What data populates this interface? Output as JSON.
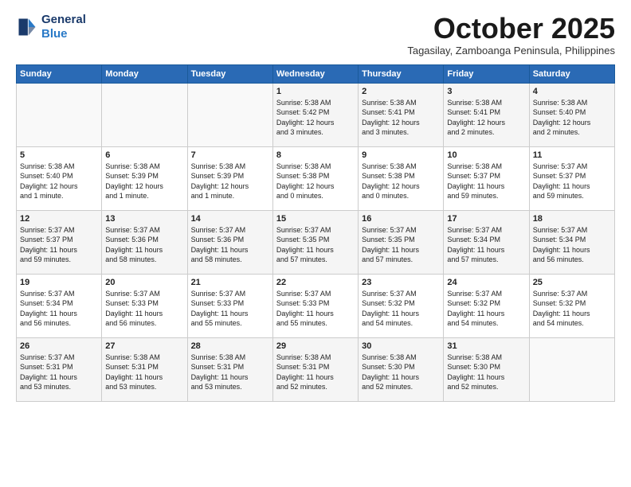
{
  "header": {
    "logo_line1": "General",
    "logo_line2": "Blue",
    "month_title": "October 2025",
    "subtitle": "Tagasilay, Zamboanga Peninsula, Philippines"
  },
  "weekdays": [
    "Sunday",
    "Monday",
    "Tuesday",
    "Wednesday",
    "Thursday",
    "Friday",
    "Saturday"
  ],
  "weeks": [
    [
      {
        "day": "",
        "info": ""
      },
      {
        "day": "",
        "info": ""
      },
      {
        "day": "",
        "info": ""
      },
      {
        "day": "1",
        "info": "Sunrise: 5:38 AM\nSunset: 5:42 PM\nDaylight: 12 hours\nand 3 minutes."
      },
      {
        "day": "2",
        "info": "Sunrise: 5:38 AM\nSunset: 5:41 PM\nDaylight: 12 hours\nand 3 minutes."
      },
      {
        "day": "3",
        "info": "Sunrise: 5:38 AM\nSunset: 5:41 PM\nDaylight: 12 hours\nand 2 minutes."
      },
      {
        "day": "4",
        "info": "Sunrise: 5:38 AM\nSunset: 5:40 PM\nDaylight: 12 hours\nand 2 minutes."
      }
    ],
    [
      {
        "day": "5",
        "info": "Sunrise: 5:38 AM\nSunset: 5:40 PM\nDaylight: 12 hours\nand 1 minute."
      },
      {
        "day": "6",
        "info": "Sunrise: 5:38 AM\nSunset: 5:39 PM\nDaylight: 12 hours\nand 1 minute."
      },
      {
        "day": "7",
        "info": "Sunrise: 5:38 AM\nSunset: 5:39 PM\nDaylight: 12 hours\nand 1 minute."
      },
      {
        "day": "8",
        "info": "Sunrise: 5:38 AM\nSunset: 5:38 PM\nDaylight: 12 hours\nand 0 minutes."
      },
      {
        "day": "9",
        "info": "Sunrise: 5:38 AM\nSunset: 5:38 PM\nDaylight: 12 hours\nand 0 minutes."
      },
      {
        "day": "10",
        "info": "Sunrise: 5:38 AM\nSunset: 5:37 PM\nDaylight: 11 hours\nand 59 minutes."
      },
      {
        "day": "11",
        "info": "Sunrise: 5:37 AM\nSunset: 5:37 PM\nDaylight: 11 hours\nand 59 minutes."
      }
    ],
    [
      {
        "day": "12",
        "info": "Sunrise: 5:37 AM\nSunset: 5:37 PM\nDaylight: 11 hours\nand 59 minutes."
      },
      {
        "day": "13",
        "info": "Sunrise: 5:37 AM\nSunset: 5:36 PM\nDaylight: 11 hours\nand 58 minutes."
      },
      {
        "day": "14",
        "info": "Sunrise: 5:37 AM\nSunset: 5:36 PM\nDaylight: 11 hours\nand 58 minutes."
      },
      {
        "day": "15",
        "info": "Sunrise: 5:37 AM\nSunset: 5:35 PM\nDaylight: 11 hours\nand 57 minutes."
      },
      {
        "day": "16",
        "info": "Sunrise: 5:37 AM\nSunset: 5:35 PM\nDaylight: 11 hours\nand 57 minutes."
      },
      {
        "day": "17",
        "info": "Sunrise: 5:37 AM\nSunset: 5:34 PM\nDaylight: 11 hours\nand 57 minutes."
      },
      {
        "day": "18",
        "info": "Sunrise: 5:37 AM\nSunset: 5:34 PM\nDaylight: 11 hours\nand 56 minutes."
      }
    ],
    [
      {
        "day": "19",
        "info": "Sunrise: 5:37 AM\nSunset: 5:34 PM\nDaylight: 11 hours\nand 56 minutes."
      },
      {
        "day": "20",
        "info": "Sunrise: 5:37 AM\nSunset: 5:33 PM\nDaylight: 11 hours\nand 56 minutes."
      },
      {
        "day": "21",
        "info": "Sunrise: 5:37 AM\nSunset: 5:33 PM\nDaylight: 11 hours\nand 55 minutes."
      },
      {
        "day": "22",
        "info": "Sunrise: 5:37 AM\nSunset: 5:33 PM\nDaylight: 11 hours\nand 55 minutes."
      },
      {
        "day": "23",
        "info": "Sunrise: 5:37 AM\nSunset: 5:32 PM\nDaylight: 11 hours\nand 54 minutes."
      },
      {
        "day": "24",
        "info": "Sunrise: 5:37 AM\nSunset: 5:32 PM\nDaylight: 11 hours\nand 54 minutes."
      },
      {
        "day": "25",
        "info": "Sunrise: 5:37 AM\nSunset: 5:32 PM\nDaylight: 11 hours\nand 54 minutes."
      }
    ],
    [
      {
        "day": "26",
        "info": "Sunrise: 5:37 AM\nSunset: 5:31 PM\nDaylight: 11 hours\nand 53 minutes."
      },
      {
        "day": "27",
        "info": "Sunrise: 5:38 AM\nSunset: 5:31 PM\nDaylight: 11 hours\nand 53 minutes."
      },
      {
        "day": "28",
        "info": "Sunrise: 5:38 AM\nSunset: 5:31 PM\nDaylight: 11 hours\nand 53 minutes."
      },
      {
        "day": "29",
        "info": "Sunrise: 5:38 AM\nSunset: 5:31 PM\nDaylight: 11 hours\nand 52 minutes."
      },
      {
        "day": "30",
        "info": "Sunrise: 5:38 AM\nSunset: 5:30 PM\nDaylight: 11 hours\nand 52 minutes."
      },
      {
        "day": "31",
        "info": "Sunrise: 5:38 AM\nSunset: 5:30 PM\nDaylight: 11 hours\nand 52 minutes."
      },
      {
        "day": "",
        "info": ""
      }
    ]
  ]
}
